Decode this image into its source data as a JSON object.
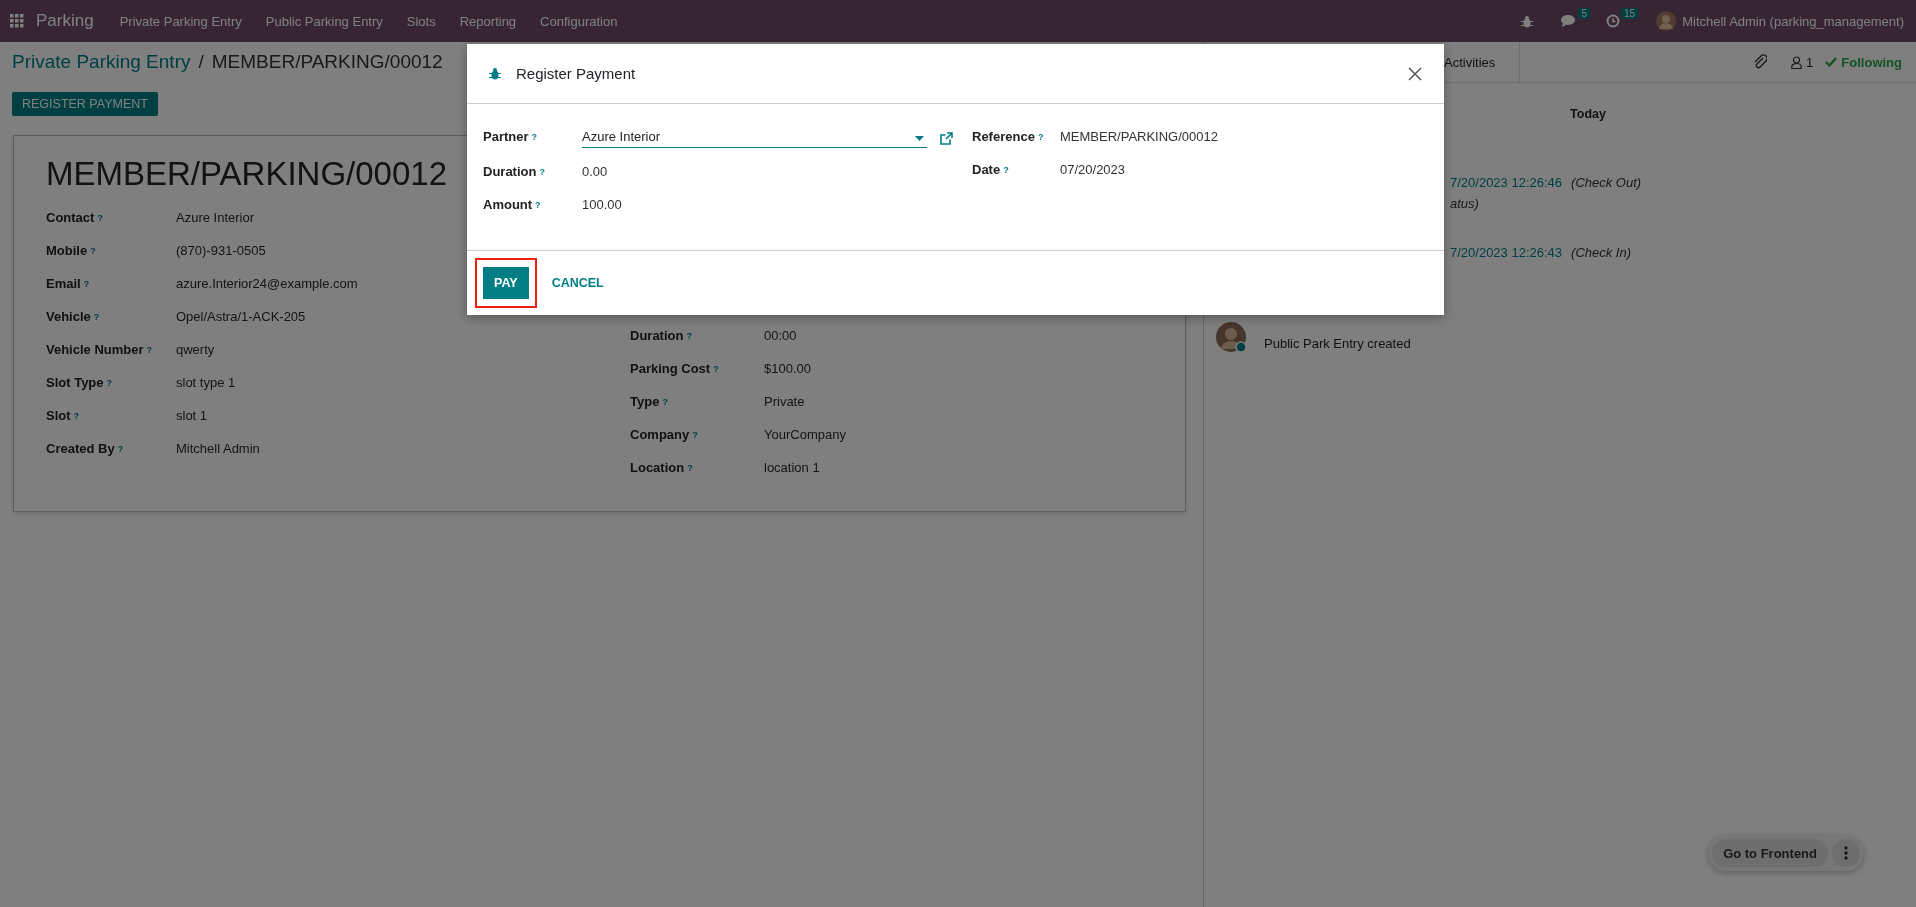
{
  "navbar": {
    "app_name": "Parking",
    "menu": [
      "Private Parking Entry",
      "Public Parking Entry",
      "Slots",
      "Reporting",
      "Configuration"
    ],
    "messages_count": "5",
    "activities_count": "15",
    "user": "Mitchell Admin (parking_management)"
  },
  "breadcrumb": {
    "parent": "Private Parking Entry",
    "separator": "/",
    "current": "MEMBER/PARKING/00012"
  },
  "actions": [
    "REGISTER PAYMENT"
  ],
  "record": {
    "title": "MEMBER/PARKING/00012",
    "left_fields": [
      {
        "label": "Contact",
        "help": "?",
        "value": "Azure Interior"
      },
      {
        "label": "Mobile",
        "help": "?",
        "value": "(870)-931-0505"
      },
      {
        "label": "Email",
        "help": "?",
        "value": "azure.Interior24@example.com"
      },
      {
        "label": "Vehicle",
        "help": "?",
        "value": "Opel/Astra/1-ACK-205"
      },
      {
        "label": "Vehicle Number",
        "help": "?",
        "value": "qwerty"
      },
      {
        "label": "Slot Type",
        "help": "?",
        "value": "slot type 1"
      },
      {
        "label": "Slot",
        "help": "?",
        "value": "slot 1"
      },
      {
        "label": "Created By",
        "help": "?",
        "value": "Mitchell Admin"
      }
    ],
    "right_fields": [
      {
        "label": "Duration",
        "help": "?",
        "value": "00:00"
      },
      {
        "label": "Parking Cost",
        "help": "?",
        "value": "$100.00"
      },
      {
        "label": "Type",
        "help": "?",
        "value": "Private"
      },
      {
        "label": "Company",
        "help": "?",
        "value": "YourCompany"
      },
      {
        "label": "Location",
        "help": "?",
        "value": "location 1"
      }
    ]
  },
  "chatter": {
    "activities_label": "Activities",
    "followers_count": "1",
    "following_label": "Following",
    "date_separator": "Today",
    "messages": [
      {
        "kind": "tracking",
        "date": "7/20/2023 12:26:46",
        "note": "(Check Out)",
        "detail": "atus)"
      },
      {
        "kind": "tracking",
        "date": "7/20/2023 12:26:43",
        "note": "(Check In)"
      },
      {
        "kind": "note",
        "text": "Public Park Entry created"
      }
    ]
  },
  "floating": {
    "button": "Go to Frontend"
  },
  "dialog": {
    "title": "Register Payment",
    "left_fields": [
      {
        "label": "Partner",
        "help": "?",
        "value": "Azure Interior",
        "kind": "many2one"
      },
      {
        "label": "Duration",
        "help": "?",
        "value": "0.00",
        "kind": "readonly"
      },
      {
        "label": "Amount",
        "help": "?",
        "value": "100.00",
        "kind": "readonly"
      }
    ],
    "right_fields": [
      {
        "label": "Reference",
        "help": "?",
        "value": "MEMBER/PARKING/00012",
        "kind": "readonly"
      },
      {
        "label": "Date",
        "help": "?",
        "value": "07/20/2023",
        "kind": "readonly"
      }
    ],
    "buttons": [
      {
        "label": "PAY",
        "kind": "primary",
        "highlighted": true
      },
      {
        "label": "CANCEL",
        "kind": "link",
        "highlighted": false
      }
    ]
  }
}
